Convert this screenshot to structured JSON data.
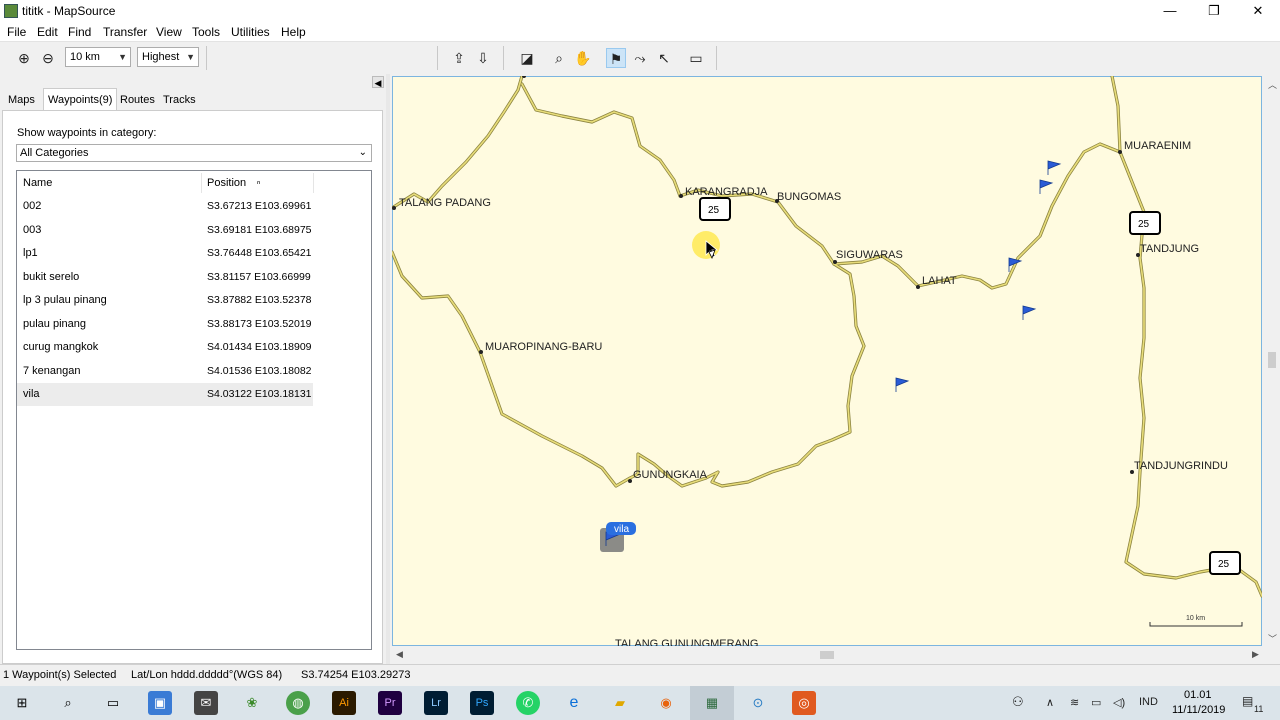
{
  "window": {
    "title": "tititk - MapSource",
    "minimize_icon": "—",
    "maximize_icon": "❐",
    "close_icon": "✕"
  },
  "menu": [
    "File",
    "Edit",
    "Find",
    "Transfer",
    "View",
    "Tools",
    "Utilities",
    "Help"
  ],
  "toolbar": {
    "zoom_value": "10 km",
    "detail_value": "Highest"
  },
  "tabs": [
    "Maps",
    "Waypoints(9)",
    "Routes",
    "Tracks"
  ],
  "waypoints_panel": {
    "category_label": "Show waypoints in category:",
    "category_value": "All Categories",
    "col_name": "Name",
    "col_position": "Position",
    "sort_indicator": "ⁿ",
    "rows": [
      {
        "name": "002",
        "position": "S3.67213 E103.69961"
      },
      {
        "name": "003",
        "position": "S3.69181 E103.68975"
      },
      {
        "name": "lp1",
        "position": "S3.76448 E103.65421"
      },
      {
        "name": "bukit serelo",
        "position": "S3.81157 E103.66999"
      },
      {
        "name": "lp 3 pulau pinang",
        "position": "S3.87882 E103.52378"
      },
      {
        "name": "pulau pinang",
        "position": "S3.88173 E103.52019"
      },
      {
        "name": "curug mangkok",
        "position": "S4.01434 E103.18909"
      },
      {
        "name": "7 kenangan",
        "position": "S4.01536 E103.18082"
      },
      {
        "name": "vila",
        "position": "S4.03122 E103.18131"
      }
    ]
  },
  "map": {
    "labels": {
      "talang_padang": "TALANG PADANG",
      "karangradja": "KARANGRADJA",
      "bungomas": "BUNGOMAS",
      "muaraenim": "MUARAENIM",
      "tandjung": "TANDJUNG",
      "siguwaras": "SIGUWARAS",
      "lahat": "LAHAT",
      "muaropinang_baru": "MUAROPINANG-BARU",
      "gunungkaia": "GUNUNGKAIA",
      "tandjungrindu": "TANDJUNGRINDU",
      "talang_gunungmerang": "TALANG GUNUNGMERANG",
      "vila_flag": "vila",
      "scale": "10 km"
    },
    "highway_number": "25",
    "colors": {
      "background": "#fffbe0",
      "road": "#c9c05c",
      "road_edge": "#8c8440",
      "flag": "#2a5bd6",
      "frame": "#7cb5e0"
    }
  },
  "status": {
    "selection": "1 Waypoint(s) Selected",
    "format": "Lat/Lon hddd.ddddd°(WGS 84)",
    "coords": "S3.74254 E103.29273"
  },
  "taskbar": {
    "tray_language": "IND",
    "time": "01.01",
    "date": "11/11/2019",
    "notification_count": "11"
  }
}
